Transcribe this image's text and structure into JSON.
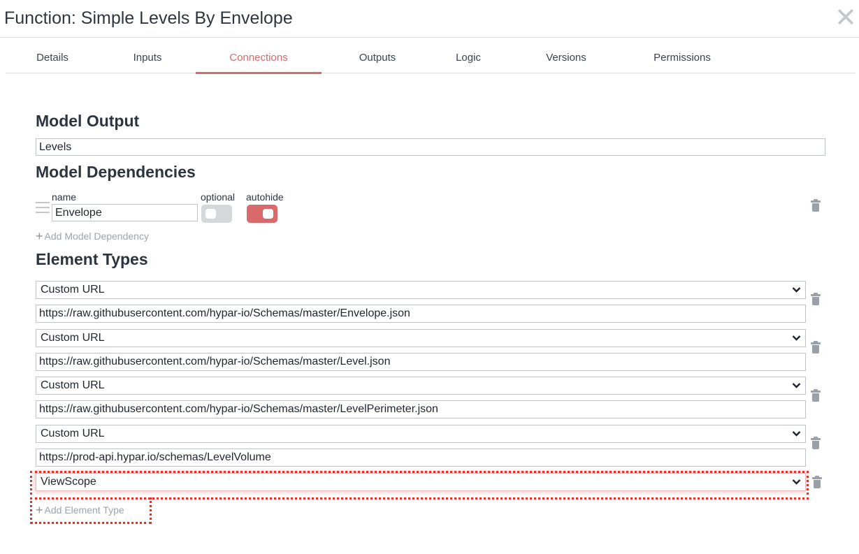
{
  "header": {
    "title": "Function: Simple Levels By Envelope",
    "close_glyph": "✕"
  },
  "tabs": [
    {
      "label": "Details",
      "active": false
    },
    {
      "label": "Inputs",
      "active": false
    },
    {
      "label": "Connections",
      "active": true
    },
    {
      "label": "Outputs",
      "active": false
    },
    {
      "label": "Logic",
      "active": false
    },
    {
      "label": "Versions",
      "active": false
    },
    {
      "label": "Permissions",
      "active": false
    }
  ],
  "model_output": {
    "heading": "Model Output",
    "value": "Levels"
  },
  "model_dependencies": {
    "heading": "Model Dependencies",
    "name_label": "name",
    "optional_label": "optional",
    "autohide_label": "autohide",
    "items": [
      {
        "name": "Envelope",
        "optional": false,
        "autohide": true
      }
    ],
    "add_label": "Add Model Dependency"
  },
  "element_types": {
    "heading": "Element Types",
    "items": [
      {
        "type": "Custom URL",
        "url": "https://raw.githubusercontent.com/hypar-io/Schemas/master/Envelope.json"
      },
      {
        "type": "Custom URL",
        "url": "https://raw.githubusercontent.com/hypar-io/Schemas/master/Level.json"
      },
      {
        "type": "Custom URL",
        "url": "https://raw.githubusercontent.com/hypar-io/Schemas/master/LevelPerimeter.json"
      },
      {
        "type": "Custom URL",
        "url": "https://prod-api.hypar.io/schemas/LevelVolume"
      },
      {
        "type": "ViewScope"
      }
    ],
    "add_label": "Add Element Type"
  },
  "colors": {
    "accent": "#d86a6c",
    "annotation": "#e0312d",
    "toggle_off": "#d6d7db",
    "icon_gray": "#9aa0a8"
  },
  "icons": {
    "close": "close-icon",
    "drag": "drag-handle-icon",
    "trash": "trash-icon",
    "chevron": "chevron-down-icon",
    "plus": "plus-icon"
  }
}
